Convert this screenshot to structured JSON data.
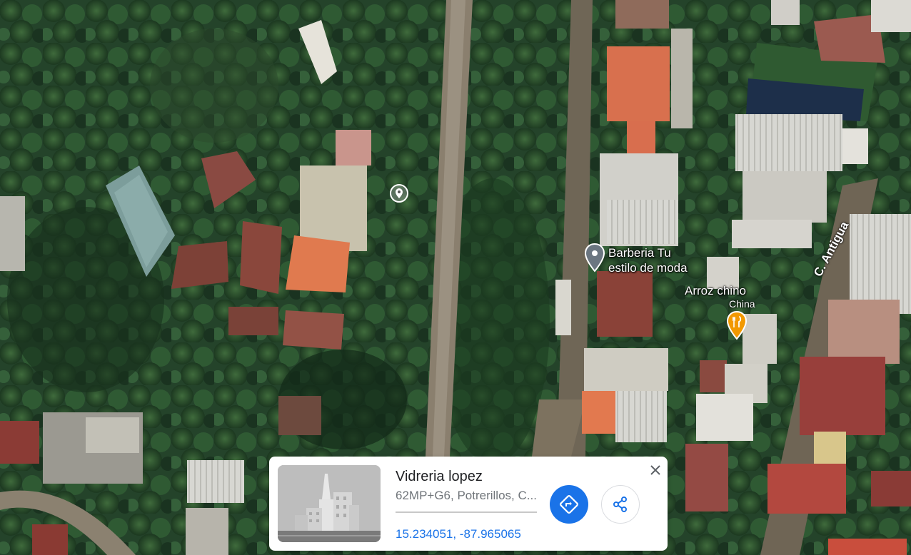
{
  "map": {
    "labels": {
      "barberia_line1": "Barberia Tu",
      "barberia_line2": "estilo de moda",
      "arroz_chino": "Arroz chino",
      "arroz_chino_sub": "China",
      "street": "C. Antigua"
    },
    "icons": {
      "dropped_pin": "location-pin-icon",
      "barberia_pin": "place-marker-icon",
      "restaurant_pin": "restaurant-icon"
    },
    "colors": {
      "restaurant_marker": "#f29900",
      "place_marker": "#6b7681"
    }
  },
  "info_card": {
    "title": "Vidreria lopez",
    "address": "62MP+G6, Potrerillos, C...",
    "coordinates": "15.234051, -87.965065",
    "directions_icon": "directions-icon",
    "share_icon": "share-icon",
    "close_icon": "close-icon",
    "accent": "#1a73e8"
  }
}
